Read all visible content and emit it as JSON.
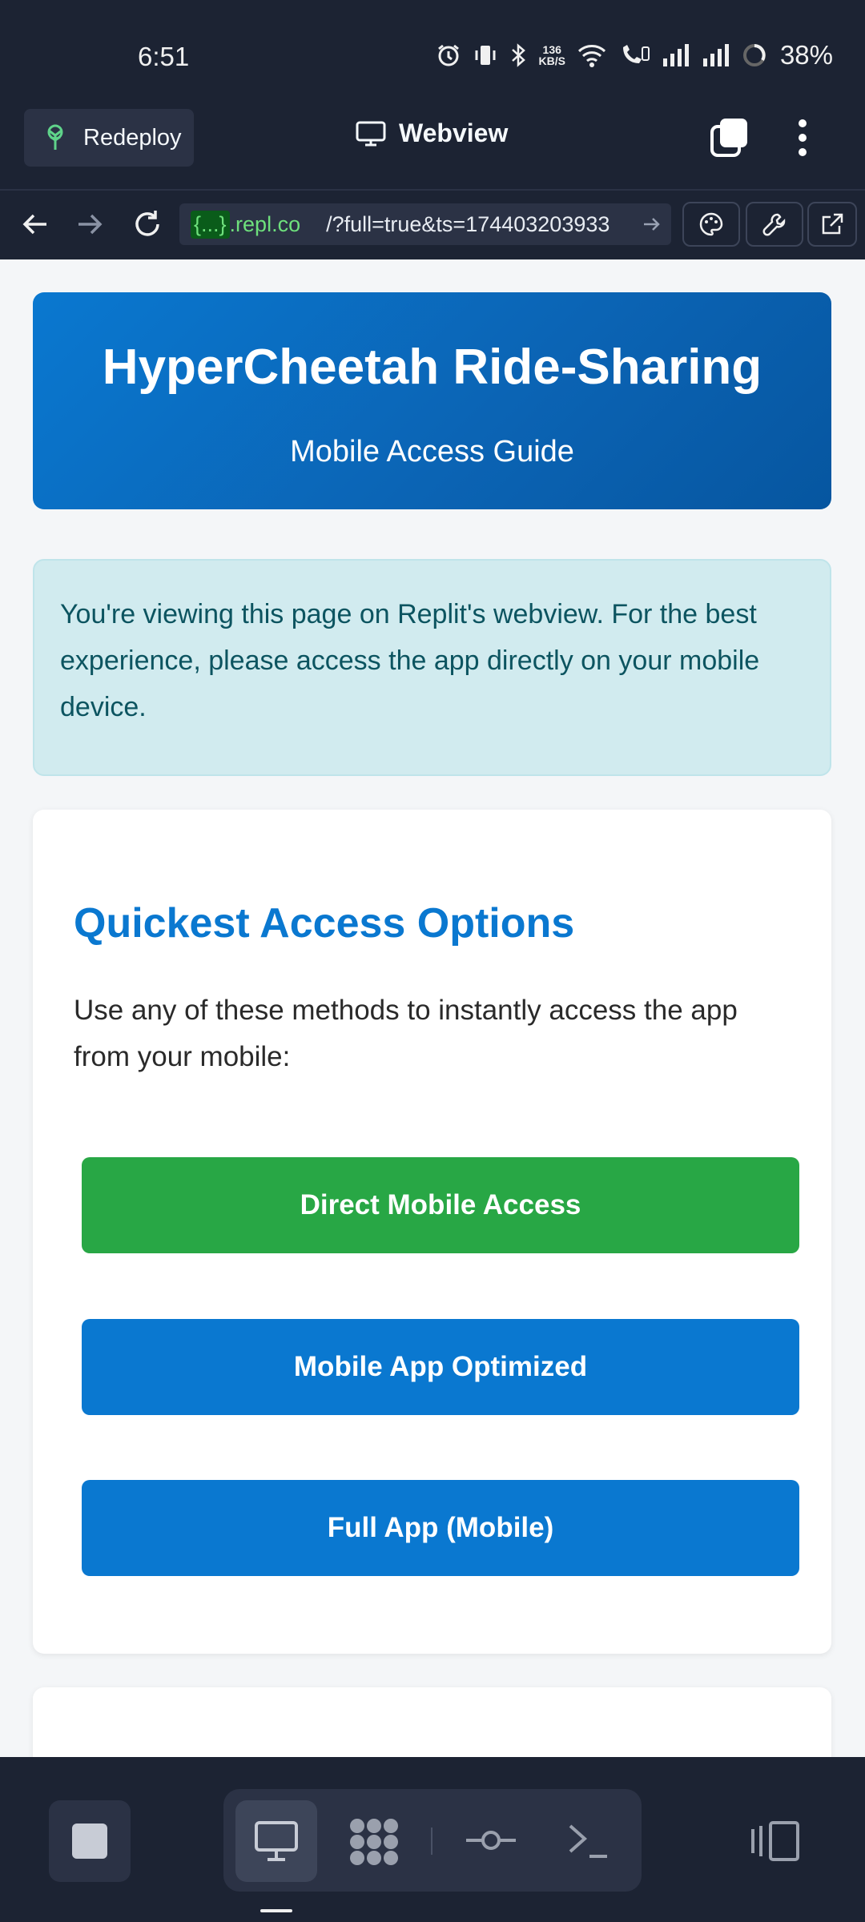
{
  "status_bar": {
    "time": "6:51",
    "net_speed_value": "136",
    "net_speed_unit": "KB/S",
    "battery": "38%"
  },
  "top_bar": {
    "redeploy_label": "Redeploy",
    "webview_label": "Webview"
  },
  "url_bar": {
    "badge": "{...}",
    "host": ".repl.co",
    "path": "/?full=true&ts=174403203933"
  },
  "hero": {
    "title": "HyperCheetah Ride-Sharing",
    "subtitle": "Mobile Access Guide"
  },
  "notice": {
    "text": "You're viewing this page on Replit's webview. For the best experience, please access the app directly on your mobile device."
  },
  "access_card": {
    "title": "Quickest Access Options",
    "description": "Use any of these methods to instantly access the app from your mobile:",
    "buttons": [
      {
        "label": "Direct Mobile Access",
        "color": "#28a745"
      },
      {
        "label": "Mobile App Optimized",
        "color": "#0a78d0"
      },
      {
        "label": "Full App (Mobile)",
        "color": "#0a78d0"
      }
    ]
  },
  "colors": {
    "app_background": "#1c2333",
    "hero_blue": "#0a78d0",
    "notice_bg": "#d1ebef",
    "notice_text": "#0c5460"
  }
}
